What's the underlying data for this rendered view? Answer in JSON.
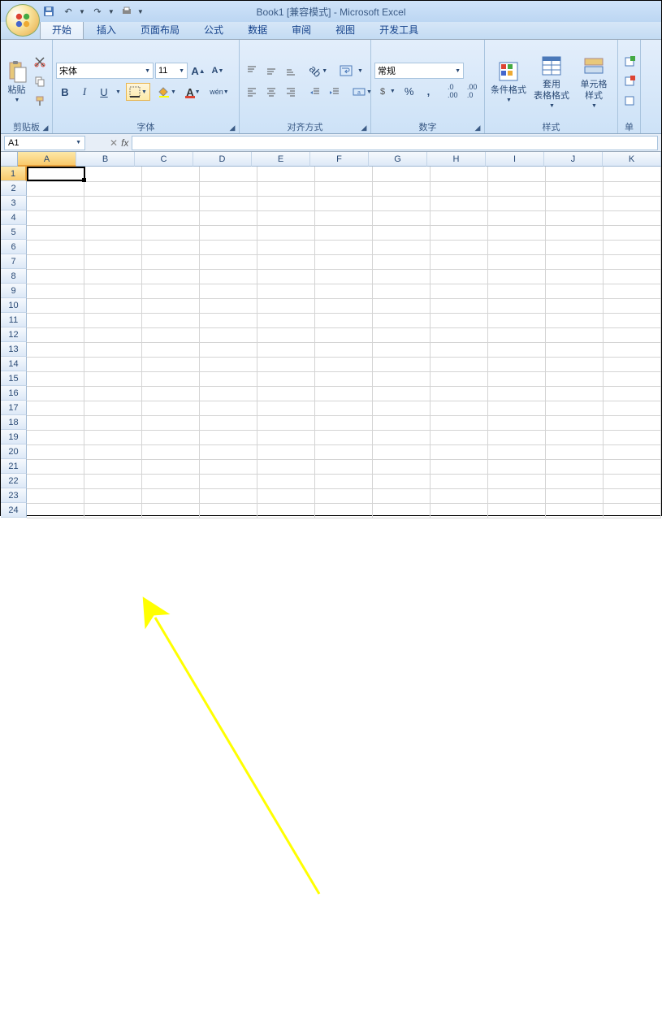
{
  "title": "Book1  [兼容模式] - Microsoft Excel",
  "tabs": [
    "开始",
    "插入",
    "页面布局",
    "公式",
    "数据",
    "审阅",
    "视图",
    "开发工具"
  ],
  "active_tab": 0,
  "groups": {
    "clipboard": "剪贴板",
    "font": "字体",
    "alignment": "对齐方式",
    "number": "数字",
    "styles": "样式",
    "cells": "单"
  },
  "clipboard": {
    "paste": "粘贴"
  },
  "font": {
    "name": "宋体",
    "size": "11"
  },
  "number": {
    "format": "常规"
  },
  "styles": {
    "cond_fmt": "条件格式",
    "format_table": "套用\n表格格式",
    "cell_styles": "单元格\n样式"
  },
  "namebox": "A1",
  "columns": [
    "A",
    "B",
    "C",
    "D",
    "E",
    "F",
    "G",
    "H",
    "I",
    "J",
    "K"
  ],
  "row_count": 24,
  "selected_cell": {
    "row": 1,
    "col": "A"
  }
}
